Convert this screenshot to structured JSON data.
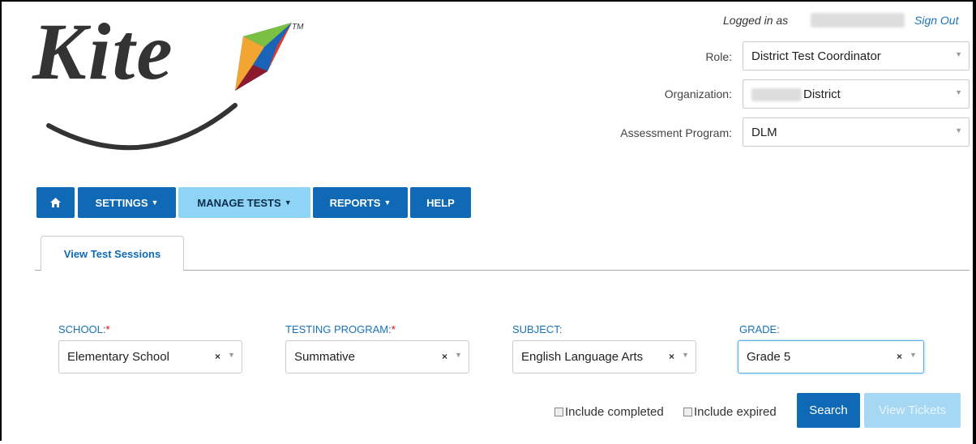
{
  "header": {
    "logo_text": "Kite",
    "logo_mark": "TM",
    "logged_in_label": "Logged in as",
    "sign_out": "Sign Out",
    "role_label": "Role:",
    "role_value": "District Test Coordinator",
    "org_label": "Organization:",
    "org_value": "District",
    "program_label": "Assessment Program:",
    "program_value": "DLM"
  },
  "nav": {
    "home_icon": "home-icon",
    "settings": "SETTINGS",
    "manage_tests": "MANAGE TESTS",
    "reports": "REPORTS",
    "help": "HELP"
  },
  "tabs": {
    "active": "View Test Sessions"
  },
  "filters": {
    "school_label": "SCHOOL:",
    "school_value": "Elementary School",
    "program_label": "TESTING PROGRAM:",
    "program_value": "Summative",
    "subject_label": "SUBJECT:",
    "subject_value": "English Language Arts",
    "grade_label": "GRADE:",
    "grade_value": "Grade 5",
    "required_mark": "*"
  },
  "actions": {
    "include_completed": "Include completed",
    "include_expired": "Include expired",
    "search": "Search",
    "view_tickets": "View Tickets"
  },
  "colors": {
    "nav_blue": "#0f69b4",
    "nav_active": "#8ed4f7",
    "link": "#1a73b8",
    "required": "#dd0000"
  }
}
